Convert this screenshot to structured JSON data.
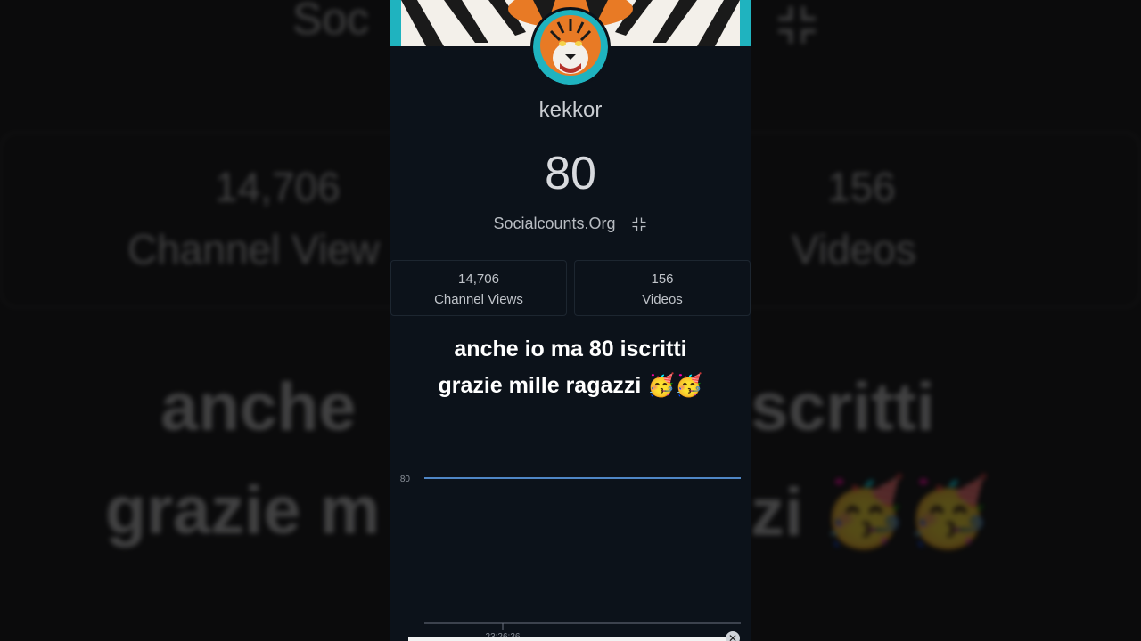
{
  "profile": {
    "username": "kekkor",
    "subscriber_count": "80",
    "site_label": "Socialcounts.Org"
  },
  "stats": [
    {
      "value": "14,706",
      "label": "Channel Views"
    },
    {
      "value": "156",
      "label": "Videos"
    }
  ],
  "caption": {
    "line1": "anche io ma 80 iscritti",
    "line2": "grazie mille ragazzi 🥳🥳"
  },
  "background": {
    "top_text": "Soc",
    "views_value": "14,706",
    "views_label": "Channel View",
    "videos_value": "156",
    "videos_label": "Videos",
    "caption_left_1": "anche",
    "caption_right_1": "scritti",
    "caption_left_2": "grazie m",
    "caption_right_2": "zi 🥳🥳"
  },
  "chart_data": {
    "type": "line",
    "x": [
      "23:26:36"
    ],
    "series": [
      {
        "values": [
          80,
          80
        ]
      }
    ],
    "y_tick_labels": [
      "80"
    ],
    "x_tick_labels": [
      "23:26:36"
    ]
  },
  "video_progress": 1.0,
  "colors": {
    "accent_line": "#4f86c6",
    "panel_bg": "#0c121a",
    "banner_teal": "#1fb3bf"
  },
  "icons": {
    "collapse": "collapse-icon",
    "close": "close-icon"
  },
  "close_glyph": "✕"
}
